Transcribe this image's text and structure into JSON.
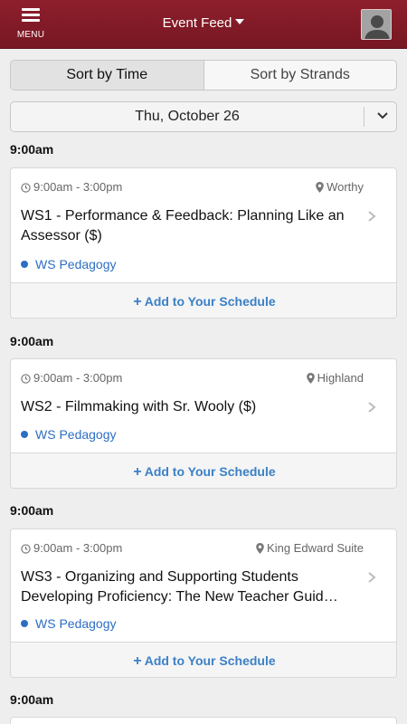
{
  "navbar": {
    "menu_label": "MENU",
    "title": "Event Feed"
  },
  "sort": {
    "by_time": "Sort by Time",
    "by_strands": "Sort by Strands"
  },
  "date_selector": {
    "label": "Thu, October 26"
  },
  "sections": [
    {
      "time": "9:00am",
      "event": {
        "time_range": "9:00am - 3:00pm",
        "location": "Worthy",
        "title": "WS1 - Performance & Feedback: Planning Like an Assessor ($)",
        "strand": "WS Pedagogy",
        "strand_color": "#2d6ec4",
        "action": "Add to Your Schedule"
      }
    },
    {
      "time": "9:00am",
      "event": {
        "time_range": "9:00am - 3:00pm",
        "location": "Highland",
        "title": "WS2 - Filmmaking with Sr. Wooly ($)",
        "strand": "WS Pedagogy",
        "strand_color": "#2d6ec4",
        "action": "Add to Your Schedule"
      }
    },
    {
      "time": "9:00am",
      "event": {
        "time_range": "9:00am - 3:00pm",
        "location": "King Edward Suite",
        "title": "WS3 - Organizing and Supporting Students Developing Proficiency: The New Teacher Guid…",
        "strand": "WS Pedagogy",
        "strand_color": "#2d6ec4",
        "action": "Add to Your Schedule"
      }
    },
    {
      "time": "9:00am"
    }
  ],
  "colors": {
    "navbar": "#8e1f2c",
    "link": "#3b80c6",
    "strand": "#2d6ec4"
  }
}
